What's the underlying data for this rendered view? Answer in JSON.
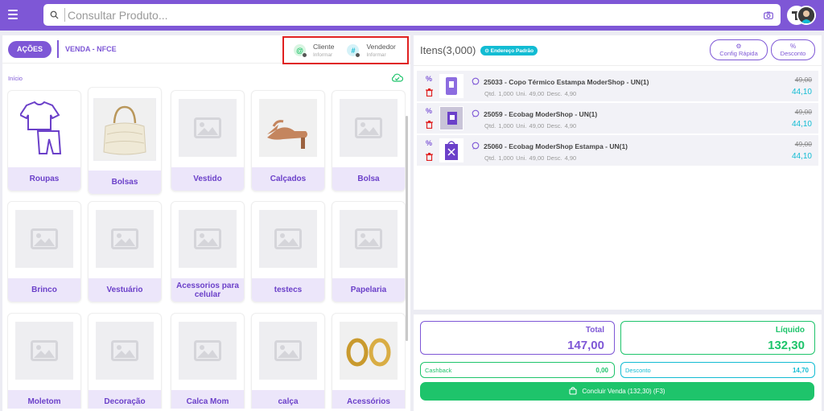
{
  "topbar": {
    "search_placeholder": "Consultar Produto..."
  },
  "left_panel": {
    "actions_label": "AÇÕES",
    "sale_type": "VENDA - NFCE",
    "customer": {
      "label": "Cliente",
      "sub": "Informar"
    },
    "seller": {
      "label": "Vendedor",
      "sub": "Informar"
    },
    "breadcrumb": "Início",
    "categories": [
      {
        "label": "Roupas"
      },
      {
        "label": "Bolsas"
      },
      {
        "label": "Vestido"
      },
      {
        "label": "Calçados"
      },
      {
        "label": "Bolsa"
      },
      {
        "label": "Brinco"
      },
      {
        "label": "Vestuário"
      },
      {
        "label": "Acessorios para celular"
      },
      {
        "label": "testecs"
      },
      {
        "label": "Papelaria"
      },
      {
        "label": "Moletom"
      },
      {
        "label": "Decoração"
      },
      {
        "label": "Calca Mom"
      },
      {
        "label": "calça"
      },
      {
        "label": "Acessórios"
      }
    ]
  },
  "cart": {
    "title": "Itens(3,000)",
    "address_badge": "⊙ Endereço Padrão",
    "config_label": "Config Rápida",
    "discount_label": "Desconto",
    "items": [
      {
        "name": "25033 - Copo Térmico Estampa ModerShop - UN(1)",
        "meta": "Qtd. 1,000  Uni. 49,00  Desc. 4,90",
        "old_price": "49,00",
        "price": "44,10"
      },
      {
        "name": "25059 - Ecobag ModerShop - UN(1)",
        "meta": "Qtd. 1,000  Uni. 49,00  Desc. 4,90",
        "old_price": "49,00",
        "price": "44,10"
      },
      {
        "name": "25060 - Ecobag ModerShop Estampa - UN(1)",
        "meta": "Qtd. 1,000  Uni. 49,00  Desc. 4,90",
        "old_price": "49,00",
        "price": "44,10"
      }
    ]
  },
  "totals": {
    "total_label": "Total",
    "total_value": "147,00",
    "net_label": "Líquido",
    "net_value": "132,30",
    "cashback_label": "Cashback",
    "cashback_value": "0,00",
    "discount_label": "Desconto",
    "discount_value": "14,70",
    "finish_label": "Concluir Venda (132,30) (F3)"
  },
  "colors": {
    "brand": "#7e57d6",
    "accent_cyan": "#12bcd3",
    "success": "#1ec46b",
    "danger": "#e02020"
  }
}
